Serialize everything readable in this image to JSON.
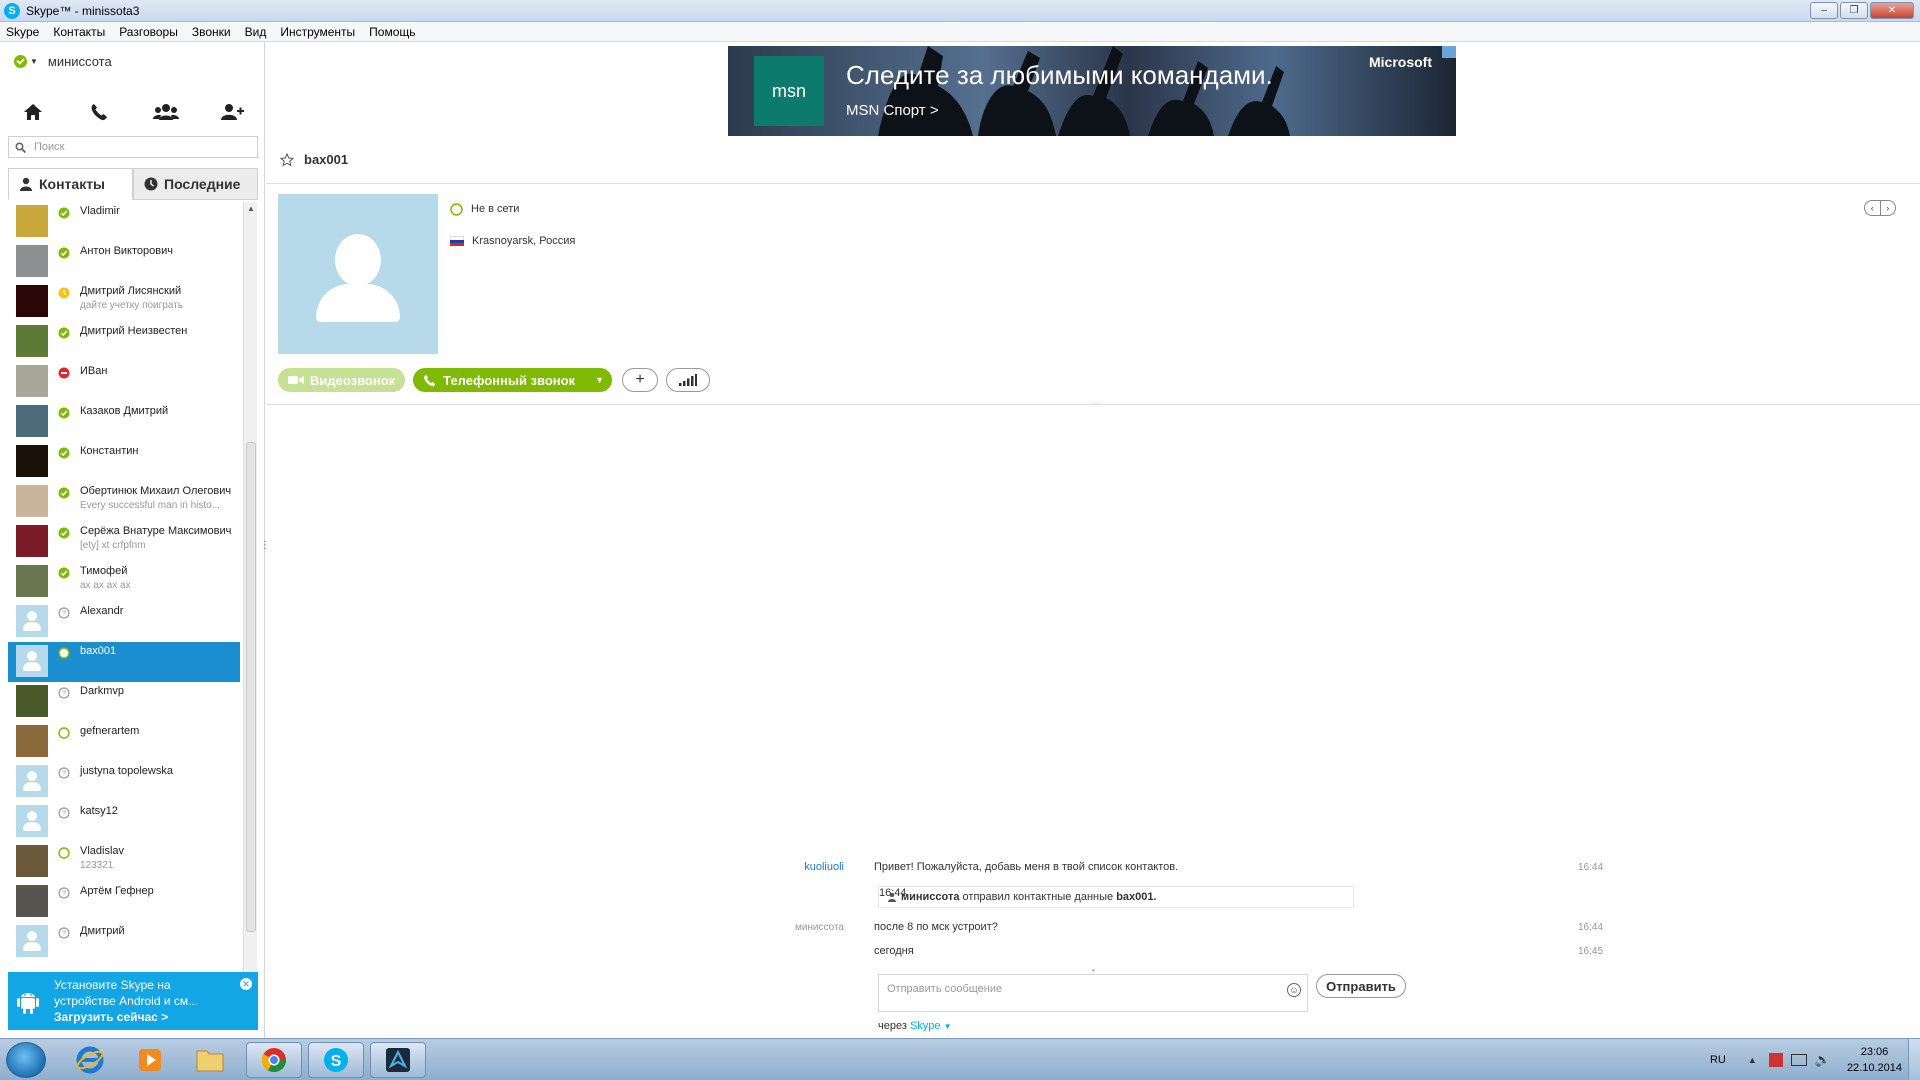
{
  "window": {
    "title": "Skype™ - minissota3"
  },
  "menu": [
    "Skype",
    "Контакты",
    "Разговоры",
    "Звонки",
    "Вид",
    "Инструменты",
    "Помощь"
  ],
  "user": {
    "name": "миниссота",
    "status_color": "#7fba00"
  },
  "search": {
    "placeholder": "Поиск"
  },
  "tabs": {
    "contacts": "Контакты",
    "recent": "Последние"
  },
  "contacts": [
    {
      "name": "Vladimir",
      "mood": "",
      "status": "online",
      "avatar": "#c8a83a"
    },
    {
      "name": "Антон Викторович",
      "mood": "",
      "status": "online",
      "avatar": "#8d8f90"
    },
    {
      "name": "Дмитрий Лисянский",
      "mood": "дайте учетку поиграть",
      "status": "away",
      "avatar": "#2a0606"
    },
    {
      "name": "Дмитрий Неизвестен",
      "mood": "",
      "status": "online",
      "avatar": "#5c7a35"
    },
    {
      "name": "ИВан",
      "mood": "",
      "status": "dnd",
      "avatar": "#a8a89a"
    },
    {
      "name": "Казаков Дмитрий",
      "mood": "",
      "status": "online",
      "avatar": "#4d6b7a"
    },
    {
      "name": "Константин",
      "mood": "",
      "status": "online",
      "avatar": "#1a1208"
    },
    {
      "name": "Обертинюк Михаил Олегович",
      "mood": "Every successful man in histo...",
      "status": "online",
      "avatar": "#c9b49c"
    },
    {
      "name": "Серёжа Внатуре Максимович",
      "mood": "[ety] xt crfpfnm",
      "status": "online",
      "avatar": "#7a1b27"
    },
    {
      "name": "Тимофей",
      "mood": "ах ах ах ах",
      "status": "online",
      "avatar": "#6a7650"
    },
    {
      "name": "Alexandr",
      "mood": "",
      "status": "unknown",
      "avatar": "default"
    },
    {
      "name": "bax001",
      "mood": "",
      "status": "offline",
      "avatar": "default",
      "selected": true
    },
    {
      "name": "Darkmvp",
      "mood": "",
      "status": "unknown",
      "avatar": "#4a5a2a"
    },
    {
      "name": "gefnerartem",
      "mood": "",
      "status": "offline",
      "avatar": "#8a6a3a"
    },
    {
      "name": "justyna topolewska",
      "mood": "",
      "status": "unknown",
      "avatar": "default"
    },
    {
      "name": "katsy12",
      "mood": "",
      "status": "unknown",
      "avatar": "default"
    },
    {
      "name": "Vladislav",
      "mood": "123321",
      "status": "offline",
      "avatar": "#6b5a3a"
    },
    {
      "name": "Артём Гефнер",
      "mood": "",
      "status": "unknown",
      "avatar": "#56544e"
    },
    {
      "name": "Дмитрий",
      "mood": "",
      "status": "unknown",
      "avatar": "default"
    }
  ],
  "promo": {
    "line1": "Установите Skype на",
    "line2": "устройстве Android и см...",
    "link": "Загрузить сейчас >"
  },
  "ad": {
    "logo": "msn",
    "headline": "Следите за любимыми командами.",
    "sub": "MSN Спорт >",
    "brand": "Microsoft"
  },
  "conversation": {
    "contact": "bax001",
    "status_text": "Не в сети",
    "location": "Krasnoyarsk, Россия",
    "video_label": "Видеозвонок",
    "call_label": "Телефонный звонок",
    "messages": [
      {
        "sender": "kuoliuoli",
        "text": "Привет! Пожалуйста, добавь меня в твой список контактов.",
        "time": "16:44"
      },
      {
        "sender": "",
        "system_bold": "миниссота",
        "text": " отправил контактные данные ",
        "bold_end": "bax001.",
        "time": "16:44"
      },
      {
        "sender": "миниссота",
        "text": "после 8 по мск устроит?",
        "time": "16:44"
      },
      {
        "sender": "",
        "text": "сегодня",
        "time": "16:45"
      }
    ],
    "input_placeholder": "Отправить сообщение",
    "send_label": "Отправить",
    "via_prefix": "через",
    "via_service": "Skype"
  },
  "taskbar": {
    "lang": "RU",
    "time": "23:06",
    "date": "22.10.2014"
  }
}
